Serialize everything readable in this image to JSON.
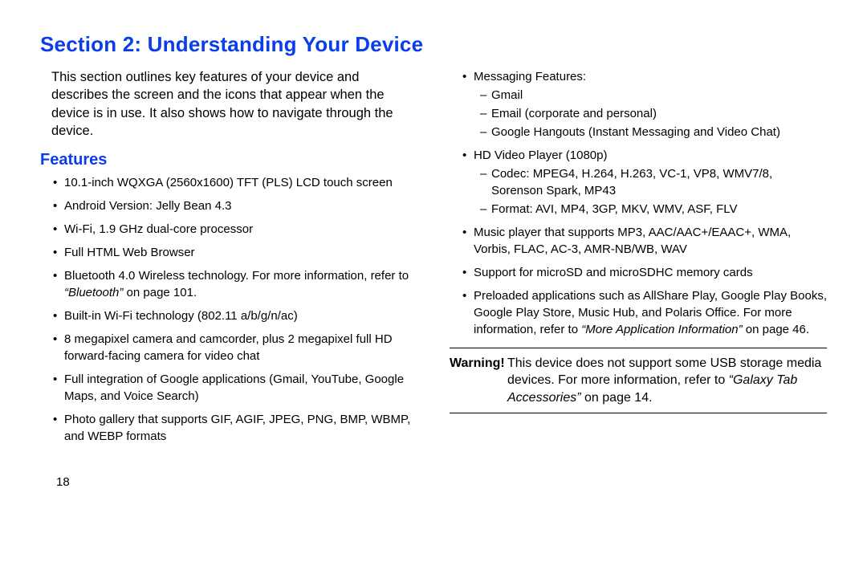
{
  "title": "Section 2: Understanding Your Device",
  "intro": "This section outlines key features of your device and describes the screen and the icons that appear when the device is in use. It also shows how to navigate through the device.",
  "features_heading": "Features",
  "left_bullets": {
    "b0": "10.1-inch WQXGA (2560x1600) TFT (PLS) LCD touch screen",
    "b1": "Android Version: Jelly Bean 4.3",
    "b2": "Wi-Fi, 1.9 GHz dual-core processor",
    "b3": "Full HTML Web Browser",
    "b4_pre": "Bluetooth 4.0 Wireless technology. For more information, refer to ",
    "b4_ref": "“Bluetooth”",
    "b4_post": " on page 101.",
    "b5": "Built-in Wi-Fi technology (802.11 a/b/g/n/ac)",
    "b6": "8 megapixel camera and camcorder, plus 2 megapixel full HD forward-facing camera for video chat",
    "b7": "Full integration of Google applications (Gmail, YouTube, Google Maps, and Voice Search)",
    "b8": "Photo gallery that supports GIF, AGIF, JPEG, PNG, BMP, WBMP, and WEBP formats"
  },
  "right_bullets": {
    "msg_label": "Messaging Features:",
    "msg_sub0": "Gmail",
    "msg_sub1": "Email (corporate and personal)",
    "msg_sub2": "Google Hangouts (Instant Messaging and Video Chat)",
    "hd_label": "HD Video Player (1080p)",
    "hd_sub0": "Codec: MPEG4, H.264, H.263, VC-1, VP8, WMV7/8, Sorenson Spark, MP43",
    "hd_sub1": "Format: AVI, MP4, 3GP, MKV, WMV, ASF, FLV",
    "music": "Music player that supports MP3, AAC/AAC+/EAAC+, WMA, Vorbis, FLAC, AC-3, AMR-NB/WB, WAV",
    "sd": "Support for microSD and microSDHC memory cards",
    "preload_pre": "Preloaded applications such as AllShare Play, Google Play Books, Google Play Store, Music Hub, and Polaris Office. For more information, refer to ",
    "preload_ref": "“More Application Information”",
    "preload_post": " on page 46."
  },
  "warning": {
    "label": "Warning!",
    "text_pre": " This device does not support some USB storage media devices. For more information, refer to ",
    "ref": "“Galaxy Tab Accessories”",
    "text_post": " on page 14."
  },
  "page_number": "18"
}
